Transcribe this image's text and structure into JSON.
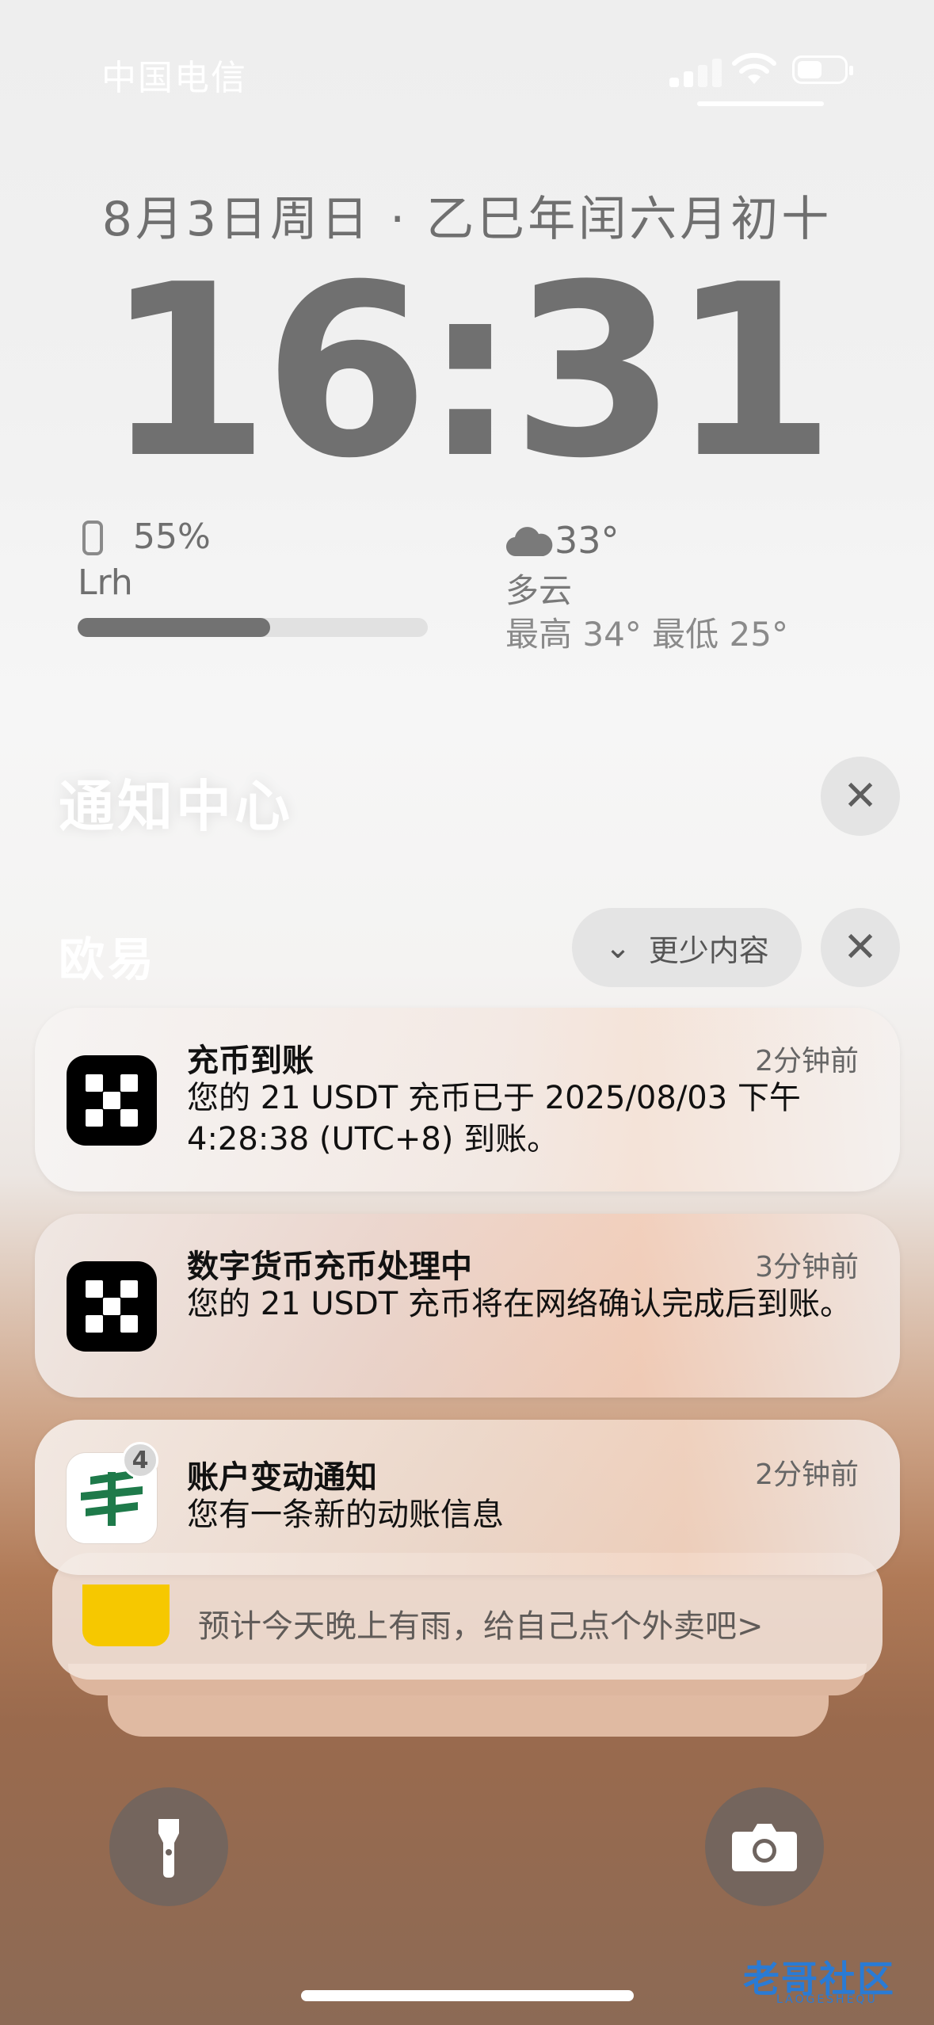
{
  "status_bar": {
    "carrier": "中国电信",
    "signal_icon": "cellular-signal-icon",
    "wifi_icon": "wifi-icon",
    "battery_icon": "battery-icon"
  },
  "lockscreen": {
    "date": "8月3日周日 · 乙巳年闰六月初十",
    "time": "16:31"
  },
  "widgets": {
    "battery": {
      "icon": "phone-icon",
      "percent": "55%",
      "device": "Lrh",
      "level": 0.55
    },
    "weather": {
      "icon": "cloud-icon",
      "temp": "33°",
      "condition": "多云",
      "range": "最高 34° 最低 25°"
    }
  },
  "notification_center": {
    "title": "通知中心",
    "close_symbol": "✕",
    "group": {
      "name": "欧易",
      "show_less_label": "更少内容",
      "chevron_symbol": "⌄",
      "close_symbol": "✕"
    },
    "notifications": [
      {
        "app_icon": "okx-icon",
        "title": "充币到账",
        "time": "2分钟前",
        "body": "您的 21 USDT 充币已于 2025/08/03 下午 4:28:38 (UTC+8) 到账。"
      },
      {
        "app_icon": "okx-icon",
        "title": "数字货币充币处理中",
        "time": "3分钟前",
        "body": "您的 21 USDT 充币将在网络确认完成后到账。"
      },
      {
        "app_icon": "china-post-icon",
        "badge": "4",
        "title": "账户变动通知",
        "time": "2分钟前",
        "body": "您有一条新的动账信息"
      }
    ],
    "stacked_preview": {
      "app_icon": "meituan-icon",
      "text": "预计今天晚上有雨，给自己点个外卖吧>"
    }
  },
  "quick_actions": {
    "flashlight_icon": "flashlight-icon",
    "camera_icon": "camera-icon"
  },
  "watermark": {
    "text": "老哥社区",
    "subtext": "LAOGESHEQU"
  },
  "colors": {
    "okx_black": "#000000",
    "post_green": "#1e7a4a",
    "meituan_yellow": "#f6c800"
  }
}
